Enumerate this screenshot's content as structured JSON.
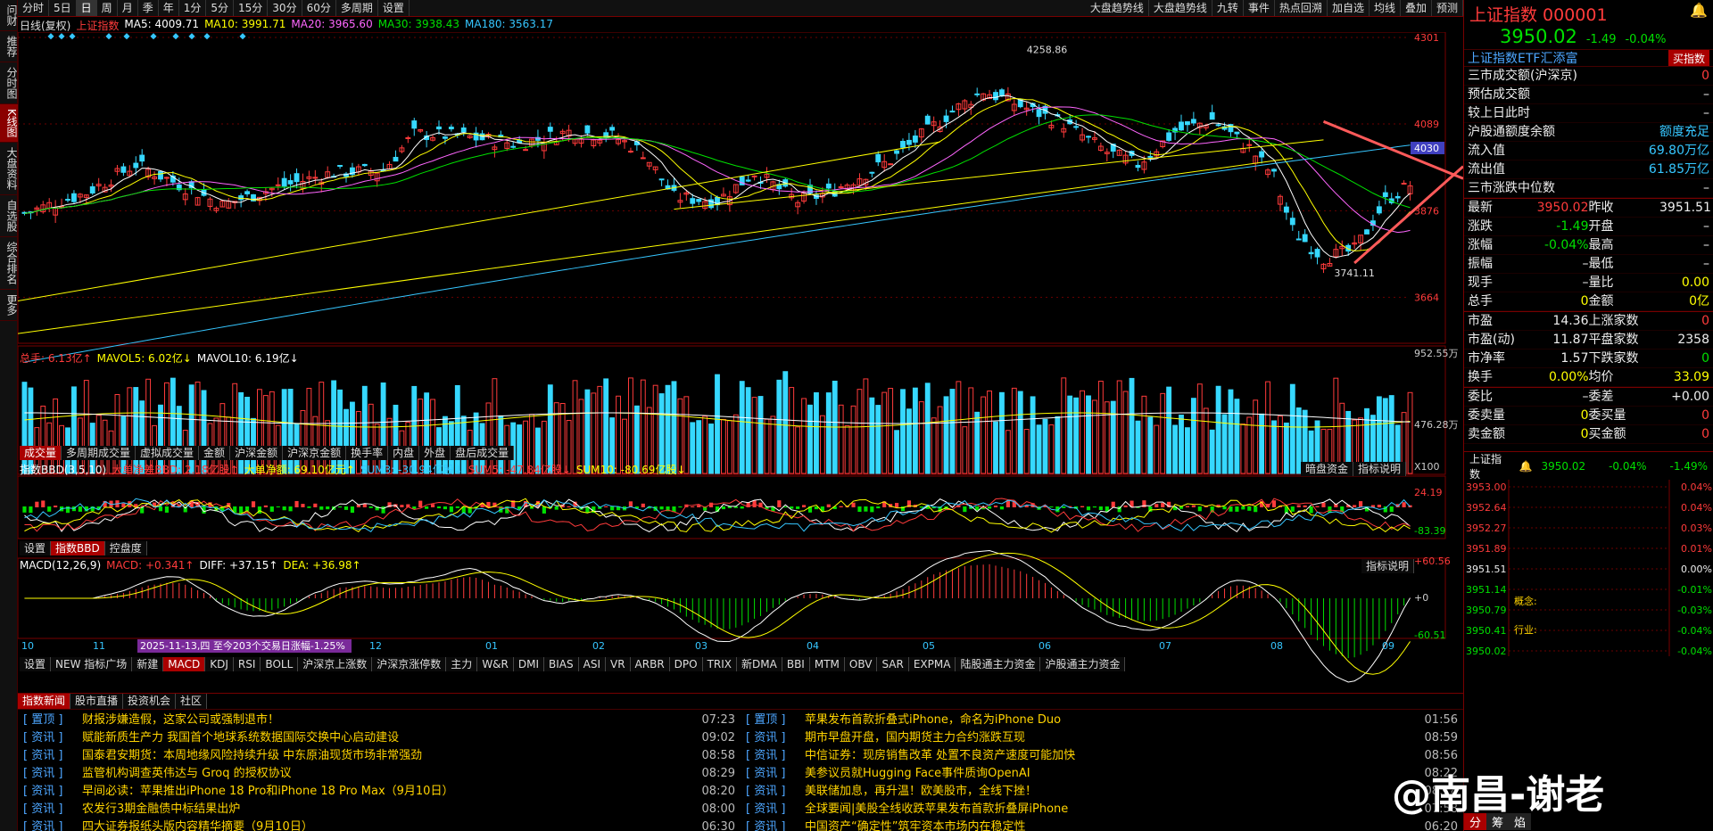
{
  "leftbar": [
    "问财",
    "推荐",
    "分时图",
    "K线图",
    "大盘资料",
    "自选股",
    "综合排名",
    "更多"
  ],
  "toolbar": {
    "items": [
      "分时",
      "5日",
      "日",
      "周",
      "月",
      "季",
      "年",
      "1分",
      "5分",
      "15分",
      "30分",
      "60分",
      "多周期",
      "设置"
    ],
    "active": "日",
    "right": [
      "大盘趋势线",
      "大盘趋势线",
      "九转",
      "事件",
      "热点回溯",
      "加自选",
      "均线",
      "叠加",
      "预测"
    ]
  },
  "main": {
    "title": "日线(复权)",
    "index": "上证指数",
    "ma": [
      {
        "label": "MA5: 4009.71",
        "color": "#ffffff"
      },
      {
        "label": "MA10: 3991.71",
        "color": "#ffff00"
      },
      {
        "label": "MA20: 3965.60",
        "color": "#ff66ff"
      },
      {
        "label": "MA30: 3938.43",
        "color": "#00e000"
      },
      {
        "label": "MA180: 3563.17",
        "color": "#36c6ff"
      }
    ],
    "ylabels": [
      "4301",
      "4089",
      "3876",
      "3664"
    ],
    "price_tag": "4030",
    "high_label": "4258.86",
    "low_label": "3741.11"
  },
  "chart_data": {
    "type": "candlestick",
    "title": "上证指数",
    "ylim": [
      3560,
      4301
    ],
    "high": 4258.86,
    "low": 3741.11,
    "last": 3950.02
  },
  "volume": {
    "legend": [
      {
        "label": "总手: 6.13亿↑",
        "color": "#ff3b3b"
      },
      {
        "label": "MAVOL5: 6.02亿↓",
        "color": "#ffff00"
      },
      {
        "label": "MAVOL10: 6.19亿↓",
        "color": "#ffffff"
      }
    ],
    "ylabels": [
      "952.55万",
      "476.28万",
      "X100"
    ],
    "tabs": [
      "成交量",
      "多周期成交量",
      "虚拟成交量",
      "金额",
      "沪深金额",
      "沪深京金额",
      "换手率",
      "内盘",
      "外盘",
      "盘后成交量"
    ]
  },
  "bbd": {
    "legend": [
      {
        "label": "指数BBD(3,5,10)",
        "color": "#ffffff"
      },
      {
        "label": "大单净差BBD: 2.18亿股↑",
        "color": "#ff3b3b"
      },
      {
        "label": "大单净额: 69.10亿元↑",
        "color": "#ffff00"
      },
      {
        "label": "SUM3: -30.94亿股↓",
        "color": "#36c6ff"
      },
      {
        "label": "SUM5: -47.84亿股↓",
        "color": "#ff3b3b"
      },
      {
        "label": "SUM10: -80.69亿股↓",
        "color": "#ffff00"
      }
    ],
    "ylabels": [
      "24.19",
      "-83.39"
    ],
    "buttons": [
      "暗盘资金",
      "指标说明"
    ],
    "tabs": [
      "设置",
      "指数BBD",
      "控盘度"
    ]
  },
  "macd": {
    "legend": [
      {
        "label": "MACD(12,26,9)",
        "color": "#ffffff"
      },
      {
        "label": "MACD: +0.341↑",
        "color": "#ff3b3b"
      },
      {
        "label": "DIFF: +37.15↑",
        "color": "#ffffff"
      },
      {
        "label": "DEA: +36.98↑",
        "color": "#ffff00"
      }
    ],
    "ylabels": [
      "+60.56",
      "+0",
      "-60.51"
    ],
    "button": "指标说明",
    "xlabels": [
      "10",
      "11",
      "12",
      "01",
      "02",
      "03",
      "04",
      "05",
      "06",
      "07",
      "08",
      "09"
    ],
    "range_note": "2025-11-13,四 至今203个交易日涨幅-1.25%"
  },
  "indicator_tabs": [
    "设置",
    "NEW 指标广场",
    "新建",
    "MACD",
    "KDJ",
    "RSI",
    "BOLL",
    "沪深京上涨数",
    "沪深京涨停数",
    "主力",
    "W&R",
    "DMI",
    "BIAS",
    "ASI",
    "VR",
    "ARBR",
    "DPO",
    "TRIX",
    "新DMA",
    "BBI",
    "MTM",
    "OBV",
    "SAR",
    "EXPMA",
    "陆股通主力资金",
    "沪股通主力资金"
  ],
  "news": {
    "tabs": [
      "指数新闻",
      "股市直播",
      "投资机会",
      "社区"
    ],
    "left": [
      {
        "tag": "[ 置顶 ]",
        "title": "财报涉嫌造假，这家公司或强制退市！",
        "time": "07:23"
      },
      {
        "tag": "[ 资讯 ]",
        "title": "赋能新质生产力 我国首个地球系统数据国际交换中心启动建设",
        "time": "09:02"
      },
      {
        "tag": "[ 资讯 ]",
        "title": "国泰君安期货：本周地缘风险持续升级 中东原油现货市场非常强劲",
        "time": "08:58"
      },
      {
        "tag": "[ 资讯 ]",
        "title": "监管机构调查英伟达与 Groq 的授权协议",
        "time": "08:29"
      },
      {
        "tag": "[ 资讯 ]",
        "title": "早间必读：苹果推出iPhone 18 Pro和iPhone 18 Pro Max（9月10日）",
        "time": "08:20"
      },
      {
        "tag": "[ 资讯 ]",
        "title": "农发行3期金融债中标结果出炉",
        "time": "08:00"
      },
      {
        "tag": "[ 资讯 ]",
        "title": "四大证券报纸头版内容精华摘要（9月10日）",
        "time": "06:30"
      }
    ],
    "right": [
      {
        "tag": "[ 置顶 ]",
        "title": "苹果发布首款折叠式iPhone，命名为iPhone Duo",
        "time": "01:56"
      },
      {
        "tag": "[ 资讯 ]",
        "title": "期市早盘开盘，国内期货主力合约涨跌互现",
        "time": "08:59"
      },
      {
        "tag": "[ 资讯 ]",
        "title": "中信证券：现房销售改革 处置不良资产速度可能加快",
        "time": "08:56"
      },
      {
        "tag": "[ 资讯 ]",
        "title": "美参议员就Hugging Face事件质询OpenAI",
        "time": "08:22"
      },
      {
        "tag": "[ 资讯 ]",
        "title": "美联储加息，再升温！欧美股市，全线下挫！",
        "time": "08:18"
      },
      {
        "tag": "[ 资讯 ]",
        "title": "全球要闻|美股全线收跌苹果发布首款折叠屏iPhone",
        "time": "07:58"
      },
      {
        "tag": "[ 资讯 ]",
        "title": "中国资产“确定性”筑牢资本市场内在稳定性",
        "time": "06:20"
      }
    ]
  },
  "right": {
    "title": "上证指数 000001",
    "price": "3950.02",
    "change": "-1.49",
    "pct": "-0.04%",
    "etf": "上证指数ETF汇添富",
    "etf_btn": "买指数",
    "info": [
      {
        "k": "三市成交额(沪深京)",
        "v": "0",
        "c": "red"
      },
      {
        "k": "预估成交额",
        "v": "–",
        "c": "white"
      },
      {
        "k": "较上日此时",
        "v": "–",
        "c": "white"
      },
      {
        "k": "沪股通额度余额",
        "v": "额度充足",
        "c": "cyan"
      },
      {
        "k": "流入值",
        "v": "69.80万亿",
        "c": "cyan"
      },
      {
        "k": "流出值",
        "v": "61.85万亿",
        "c": "cyan"
      },
      {
        "k": "三市涨跌中位数",
        "v": "–",
        "c": "white"
      }
    ],
    "quote": [
      [
        "最新",
        "3950.02",
        "red",
        "昨收",
        "3951.51",
        "white"
      ],
      [
        "涨跌",
        "-1.49",
        "green",
        "开盘",
        "–",
        "white"
      ],
      [
        "涨幅",
        "-0.04%",
        "green",
        "最高",
        "–",
        "white"
      ],
      [
        "振幅",
        "–",
        "white",
        "最低",
        "–",
        "white"
      ],
      [
        "现手",
        "–",
        "white",
        "量比",
        "0.00",
        "yellow"
      ],
      [
        "总手",
        "0",
        "yellow",
        "金额",
        "0亿",
        "yellow"
      ]
    ],
    "fund": [
      [
        "市盈",
        "14.36",
        "white",
        "上涨家数",
        "0",
        "red"
      ],
      [
        "市盈(动)",
        "11.87",
        "white",
        "平盘家数",
        "2358",
        "white"
      ],
      [
        "市净率",
        "1.57",
        "white",
        "下跌家数",
        "0",
        "green"
      ],
      [
        "换手",
        "0.00%",
        "yellow",
        "均价",
        "33.09",
        "yellow"
      ]
    ],
    "order": [
      [
        "委比",
        "–",
        "white",
        "委差",
        "+0.00",
        "white"
      ],
      [
        "委卖量",
        "0",
        "yellow",
        "委买量",
        "0",
        "red"
      ],
      [
        "卖金额",
        "0",
        "yellow",
        "买金额",
        "0",
        "red"
      ]
    ],
    "mini": {
      "name": "上证指数",
      "price": "3950.02",
      "chg": "-0.04%",
      "pct": "-1.49%",
      "left": [
        "3953.00",
        "3952.64",
        "3952.27",
        "3951.89",
        "3951.51",
        "3951.14",
        "3950.79",
        "3950.41",
        "3950.02"
      ],
      "right": [
        "0.04%",
        "0.04%",
        "0.03%",
        "0.01%",
        "0.00%",
        "-0.01%",
        "-0.03%",
        "-0.04%",
        "-0.04%"
      ],
      "labels": [
        "概念:",
        "行业:"
      ]
    },
    "bottom_tabs": [
      "分",
      "筹",
      "焰"
    ]
  },
  "watermark": "@南昌-谢老"
}
